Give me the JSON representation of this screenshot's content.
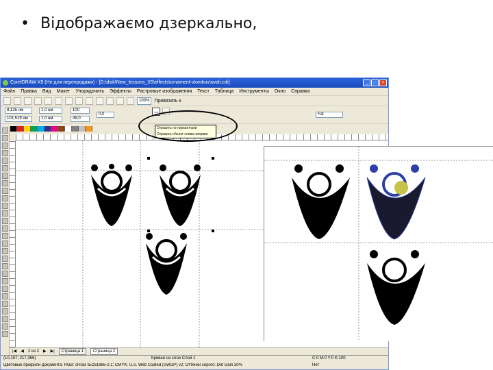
{
  "slide": {
    "bullet": "•",
    "text": "Відображаємо дзеркально,"
  },
  "app": {
    "title": "CorelDRAW X5 (Не для перепродажи) - [D:\\disk\\New_lessons_X5\\effects\\ornament-vlomkov\\ovali.cdr]",
    "menu": [
      "Файл",
      "Правка",
      "Вид",
      "Макет",
      "Упорядочить",
      "Эффекты",
      "Растровые изображения",
      "Текст",
      "Таблица",
      "Инструменты",
      "Окно",
      "Справка"
    ],
    "zoom": "103%",
    "snap_label": "Привязать к",
    "prop": {
      "x": "8,125 нм",
      "y": "101,519 нм",
      "w": "1,0 нм",
      "h": "1,0 нм",
      "pct1": "100",
      "pct2": "49,0",
      "angle": "0,0",
      "font": "Fat"
    },
    "tooltip": {
      "line1": "Отразить по горизонтали",
      "line2": "Отразить объект слева направо"
    },
    "pages": {
      "nav": "2 из 2",
      "tab1": "Страница 1",
      "tab2": "Страница 2"
    },
    "status": {
      "coords": "(10,197; 217,366)",
      "center": "Кривая на слое Слой 1",
      "profile": "Цветовые профили документа: RGB: sRGB IEC61966-2.1; CMYK: U.S. Web Coated (SWOP) v2; Оттенки серого: Dot Gain 20%",
      "fill": "C:0 M:0 Y:0 K:100",
      "outline": "Нет"
    },
    "palette_colors": [
      "#000000",
      "#e2231a",
      "#ffd400",
      "#00a651",
      "#00aeef",
      "#2e3192",
      "#ec008c",
      "#8b4513",
      "#ffffff",
      "#808080",
      "#c0c0c0",
      "#f7941d"
    ]
  }
}
